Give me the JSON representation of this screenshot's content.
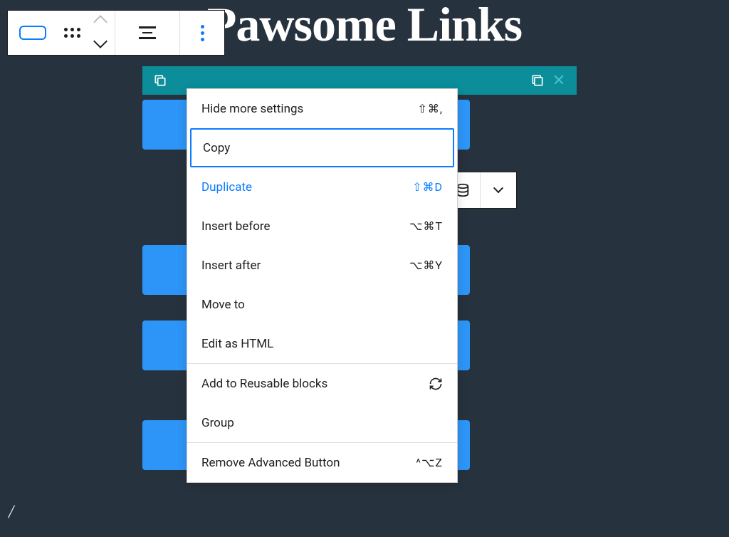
{
  "page": {
    "title": "Pawsome Links",
    "slash": "/"
  },
  "dropdown": {
    "items": [
      {
        "label": "Hide more settings",
        "shortcut": "⇧⌘,"
      },
      {
        "label": "Copy",
        "shortcut": ""
      },
      {
        "label": "Duplicate",
        "shortcut": "⇧⌘D"
      },
      {
        "label": "Insert before",
        "shortcut": "⌥⌘T"
      },
      {
        "label": "Insert after",
        "shortcut": "⌥⌘Y"
      },
      {
        "label": "Move to",
        "shortcut": ""
      },
      {
        "label": "Edit as HTML",
        "shortcut": ""
      },
      {
        "label": "Add to Reusable blocks",
        "shortcut": ""
      },
      {
        "label": "Group",
        "shortcut": ""
      },
      {
        "label": "Remove Advanced Button",
        "shortcut": "^⌥Z"
      }
    ]
  }
}
